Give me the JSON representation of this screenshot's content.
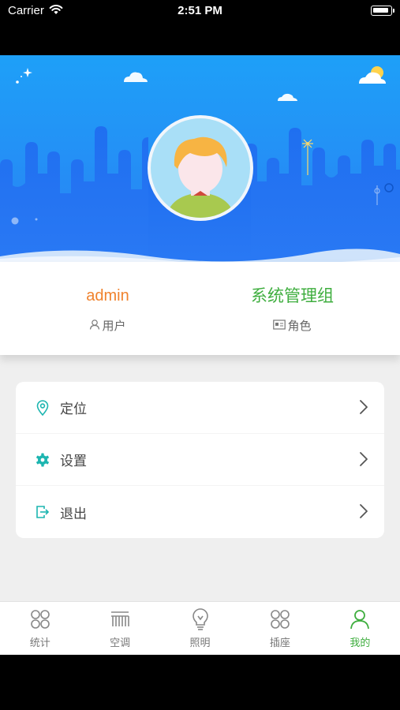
{
  "status_bar": {
    "carrier": "Carrier",
    "time": "2:51 PM"
  },
  "profile": {
    "username": "admin",
    "user_label": "用户",
    "role": "系统管理组",
    "role_label": "角色"
  },
  "menu": {
    "items": [
      {
        "label": "定位",
        "icon": "location-pin-icon"
      },
      {
        "label": "设置",
        "icon": "gear-icon"
      },
      {
        "label": "退出",
        "icon": "logout-icon"
      }
    ]
  },
  "tabbar": {
    "active_index": 4,
    "items": [
      {
        "label": "统计",
        "icon": "grid-circles-icon"
      },
      {
        "label": "空调",
        "icon": "air-conditioner-icon"
      },
      {
        "label": "照明",
        "icon": "light-bulb-icon"
      },
      {
        "label": "插座",
        "icon": "socket-icon"
      },
      {
        "label": "我的",
        "icon": "person-icon"
      }
    ]
  },
  "colors": {
    "hero_blue": "#2a8af6",
    "username": "#f0822d",
    "role": "#3fae3f",
    "accent_teal": "#1cb5b0",
    "tab_active": "#3fae3f"
  }
}
